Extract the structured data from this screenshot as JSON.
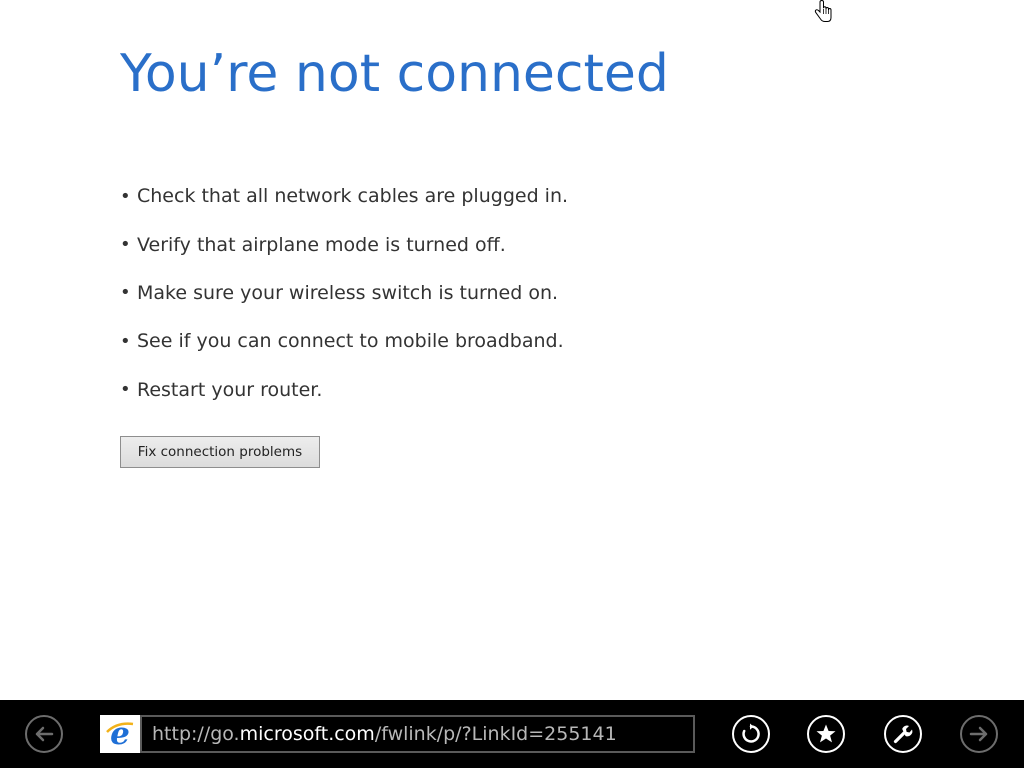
{
  "page": {
    "title": "You’re not connected",
    "tips": [
      "Check that all network cables are plugged in.",
      "Verify that airplane mode is turned off.",
      "Make sure your wireless switch is turned on.",
      "See if you can connect to mobile broadband.",
      "Restart your router."
    ],
    "fix_button_label": "Fix connection problems"
  },
  "appbar": {
    "address": {
      "prefix": "http://go.",
      "host": "microsoft.com",
      "suffix": "/fwlink/p/?LinkId=255141"
    },
    "buttons": {
      "back": "back-arrow-icon",
      "refresh": "refresh-icon",
      "favorites": "star-icon",
      "tools": "wrench-icon",
      "forward": "forward-arrow-icon"
    }
  },
  "colors": {
    "title": "#2a6fc9",
    "appbar_bg": "#000000",
    "address_text": "#b8b8b8",
    "ie_blue": "#1e6fd6"
  }
}
